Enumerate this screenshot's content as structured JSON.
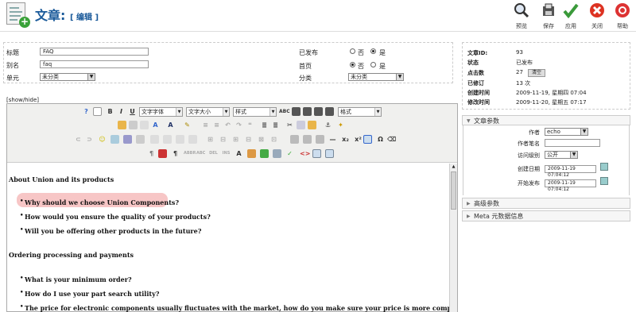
{
  "header": {
    "title": "文章:",
    "subtitle": "[ 编辑 ]",
    "toolbar": [
      {
        "label": "预览",
        "icon": "preview-icon"
      },
      {
        "label": "保存",
        "icon": "save-icon"
      },
      {
        "label": "应用",
        "icon": "apply-icon"
      },
      {
        "label": "关闭",
        "icon": "close-icon"
      },
      {
        "label": "帮助",
        "icon": "help-icon"
      }
    ]
  },
  "form": {
    "title_label": "标题",
    "title_value": "FAQ",
    "alias_label": "别名",
    "alias_value": "faq",
    "section_label": "单元",
    "section_value": "未分类",
    "published_label": "已发布",
    "frontpage_label": "首页",
    "category_label": "分类",
    "category_value": "未分类",
    "no_label": "否",
    "yes_label": "是"
  },
  "editor": {
    "showhide": "[show/hide]",
    "font_family": "文字字体",
    "font_size": "文字大小",
    "style": "样式",
    "format": "格式",
    "content": [
      {
        "type": "heading",
        "text": "About Union and its products"
      },
      {
        "type": "bullet",
        "text": "Why should we choose Union Components?"
      },
      {
        "type": "bullet",
        "text": "How would you ensure the quality of your products?"
      },
      {
        "type": "bullet",
        "text": "Will you be offering other products in the future?"
      },
      {
        "type": "heading",
        "text": "Ordering processing and payments"
      },
      {
        "type": "bullet",
        "text": "What is your minimum order?"
      },
      {
        "type": "bullet",
        "text": "How do I use your part search utility?"
      },
      {
        "type": "bullet",
        "text": "The price for electronic components usually fluctuates with the market, how do you make sure your price is more competitive than others?"
      }
    ]
  },
  "info": {
    "rows": [
      {
        "k": "文章ID:",
        "v": "93"
      },
      {
        "k": "状态",
        "v": "已发布"
      },
      {
        "k": "点击数",
        "v": "27"
      },
      {
        "k": "已修订",
        "v": "13 次"
      },
      {
        "k": "创建时间",
        "v": "2009-11-19, 星期四 07:04"
      },
      {
        "k": "修改时间",
        "v": "2009-11-20, 星期五 07:17"
      }
    ],
    "reset_label": "清空"
  },
  "params": {
    "header": "文章参数",
    "author_label": "作者",
    "author_value": "echo",
    "alias_label": "作者笔名",
    "alias_value": "",
    "access_label": "访问级别",
    "access_value": "公开",
    "created_label": "创建日期",
    "created_value": "2009-11-19 07:04:12",
    "publish_label": "开始发布",
    "publish_value": "2009-11-19 07:04:12"
  },
  "advanced": {
    "header": "高级参数"
  },
  "meta": {
    "header": "Meta 元数据信息"
  }
}
